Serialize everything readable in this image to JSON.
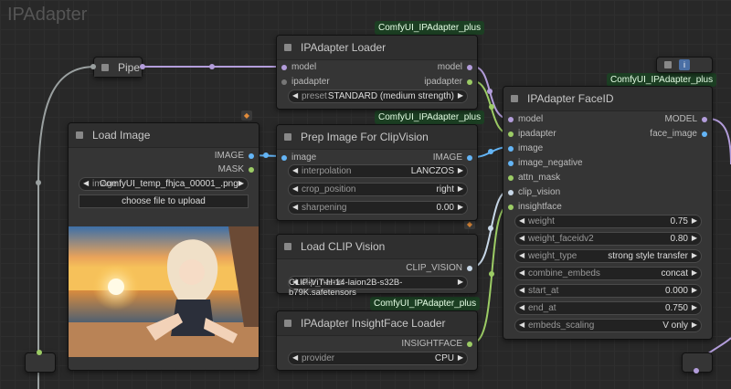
{
  "group": {
    "title": "IPAdapter"
  },
  "badges": {
    "plus1": "ComfyUI_IPAdapter_plus",
    "plus2": "ComfyUI_IPAdapter_plus",
    "plus3": "ComfyUI_IPAdapter_plus",
    "plus4": "ComfyUI_IPAdapter_plus"
  },
  "pipe": {
    "title": "Pipe"
  },
  "loader": {
    "title": "IPAdapter Loader",
    "in_model": "model",
    "in_ipadapter": "ipadapter",
    "out_model": "model",
    "out_ipadapter": "ipadapter",
    "preset_label": "preset",
    "preset_value": "STANDARD (medium strength)"
  },
  "load_image": {
    "title": "Load Image",
    "out_image": "IMAGE",
    "out_mask": "MASK",
    "image_label": "image",
    "image_value": "ComfyUI_temp_fhjca_00001_.png",
    "upload_button": "choose file to upload"
  },
  "prep": {
    "title": "Prep Image For ClipVision",
    "in_image": "image",
    "out_image": "IMAGE",
    "interp_label": "interpolation",
    "interp_value": "LANCZOS",
    "crop_label": "crop_position",
    "crop_value": "right",
    "sharp_label": "sharpening",
    "sharp_value": "0.00"
  },
  "clip": {
    "title": "Load CLIP Vision",
    "out": "CLIP_VISION",
    "name_label": "clip_name",
    "name_value": "CLIP-ViT-H-14-laion2B-s32B-b79K.safetensors"
  },
  "insight": {
    "title": "IPAdapter InsightFace Loader",
    "out": "INSIGHTFACE",
    "provider_label": "provider",
    "provider_value": "CPU"
  },
  "faceid": {
    "title": "IPAdapter FaceID",
    "out_model": "MODEL",
    "out_face": "face_image",
    "inputs": [
      "model",
      "ipadapter",
      "image",
      "image_negative",
      "attn_mask",
      "clip_vision",
      "insightface"
    ],
    "widgets": [
      {
        "label": "weight",
        "value": "0.75"
      },
      {
        "label": "weight_faceidv2",
        "value": "0.80"
      },
      {
        "label": "weight_type",
        "value": "strong style transfer"
      },
      {
        "label": "combine_embeds",
        "value": "concat"
      },
      {
        "label": "start_at",
        "value": "0.000"
      },
      {
        "label": "end_at",
        "value": "0.750"
      },
      {
        "label": "embeds_scaling",
        "value": "V only"
      }
    ]
  },
  "colors": {
    "model": "#b39ddb",
    "image": "#64b5f6",
    "clip": "#a5d6a7",
    "ipadapter": "#9ccc65",
    "link_grey": "#9aa0a0"
  }
}
